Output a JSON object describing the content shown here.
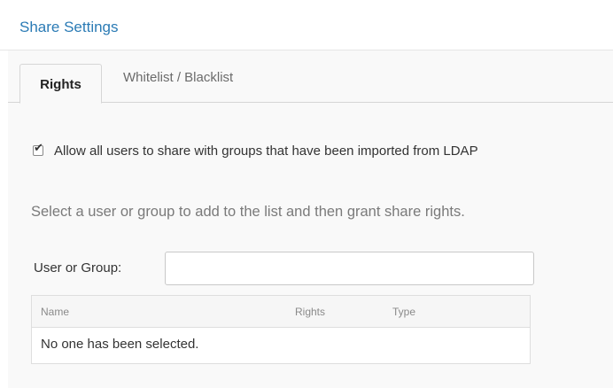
{
  "header": {
    "title": "Share Settings"
  },
  "tabs": [
    {
      "label": "Rights",
      "active": true
    },
    {
      "label": "Whitelist / Blacklist",
      "active": false
    }
  ],
  "rights": {
    "ldap_checkbox": {
      "label": "Allow all users to share with groups that have been imported from LDAP",
      "checked": true
    },
    "instructions": "Select a user or group to add to the list and then grant share rights.",
    "user_group_field": {
      "label": "User or Group:",
      "value": "",
      "placeholder": ""
    },
    "table": {
      "columns": [
        "Name",
        "Rights",
        "Type"
      ],
      "rows": [],
      "empty_message": "No one has been selected."
    }
  },
  "colors": {
    "title": "#2b7bb5",
    "panel_background": "#f9f9f9",
    "border": "#d6d6d6"
  }
}
